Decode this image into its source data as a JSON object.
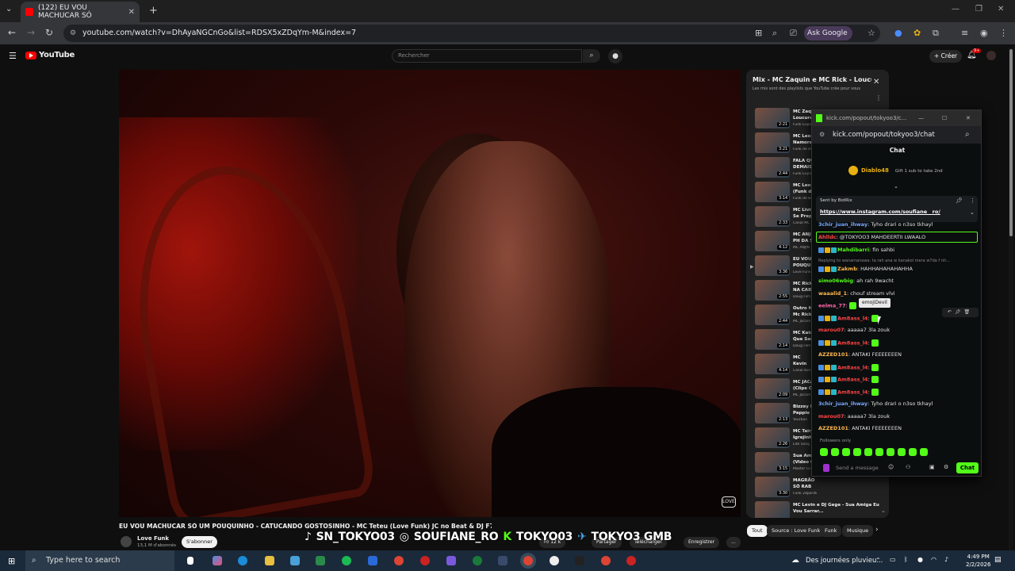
{
  "browser": {
    "tab_title": "(122) EU VOU MACHUCAR SÓ",
    "tab_close": "✕",
    "new_tab": "+",
    "url": "youtube.com/watch?v=DhAyaNGCnGo&list=RDSX5xZDqYm-M&index=7",
    "ask_google": "Ask Google"
  },
  "youtube": {
    "logo_text": "YouTube",
    "search_placeholder": "Rechercher",
    "create_label": "+ Créer",
    "notif_count": "9+"
  },
  "video": {
    "title": "EU VOU MACHUCAR SÓ UM POUQUINHO - CATUCANDO GOSTOSINHO - MC Teteu (Love Funk) JC no Beat & DJ F7",
    "channel_name": "Love Funk",
    "channel_subs": "13,1 M d'abonnés",
    "subscribe": "S'abonner",
    "like_count": "12 k",
    "share": "Partager",
    "download": "Télécharger",
    "save": "Enregistrer",
    "more": "..."
  },
  "overlay_socials": {
    "tiktok": "SN_TOKYO03",
    "instagram": "SOUFIANE_RO",
    "kick": "TOKYO03",
    "telegram": "TOKYO3 GMB"
  },
  "playlist": {
    "title": "Mix - MC Zaquin e MC Rick - Loucura",
    "subtitle": "Les mix sont des playlists que YouTube crée pour vous",
    "items": [
      {
        "name": "MC Zaq Loucura",
        "artist": "Funk Explo",
        "dur": "2:21"
      },
      {
        "name": "MC Leoz Namora",
        "artist": "Funk de Bl",
        "dur": "3:21"
      },
      {
        "name": "FALA QU DEMAIS",
        "artist": "Funk Explo",
        "dur": "2:44"
      },
      {
        "name": "MC Leoz (Funk de",
        "artist": "Funk de Bl",
        "dur": "3:14"
      },
      {
        "name": "MC Livin Se Prepa",
        "artist": "Canal MC",
        "dur": "2:33"
      },
      {
        "name": "MC ANJO PH DA S",
        "artist": "MC ANJIN",
        "dur": "4:12"
      },
      {
        "name": "EU VOU POUQUI",
        "artist": "Love Funk",
        "dur": "3:36"
      },
      {
        "name": "MC Rick NA CABE",
        "artist": "Doug Film",
        "dur": "2:55"
      },
      {
        "name": "Outro M Mc Rick",
        "artist": "MC Jacaré",
        "dur": "2:44"
      },
      {
        "name": "MC Kaio Que Sau",
        "artist": "Doug Film",
        "dur": "2:14"
      },
      {
        "name": "MC Kevin (KondZ",
        "artist": "Canal Kon",
        "dur": "4:14"
      },
      {
        "name": "MC JACA (Clipe O",
        "artist": "MC Jacaré",
        "dur": "2:09"
      },
      {
        "name": "Bizzey F Pappie -",
        "artist": "Yourban",
        "dur": "2:13"
      },
      {
        "name": "MC Tairi Igrejinha",
        "artist": "Lite Song",
        "dur": "2:26"
      },
      {
        "name": "Sua Ami (Video C",
        "artist": "Master Gro",
        "dur": "3:15"
      },
      {
        "name": "MAGRÃO SÓ RAB Oficial) DJ IDK",
        "artist": "Funk 24por48",
        "dur": "3:30"
      },
      {
        "name": "MC Levin e DJ Gege - Sua Amiga Eu Vou Sarrar...",
        "artist": "",
        "dur": ""
      }
    ]
  },
  "chips": [
    "Tout",
    "Source : Love Funk",
    "Funk",
    "Musique"
  ],
  "kick": {
    "window_title": "kick.com/popout/tokyoo3/c...",
    "url": "kick.com/popout/tokyoo3/chat",
    "chat_label": "Chat",
    "gift_user": "Diablo48",
    "gift_text": "Gift 1 sub to take 2nd",
    "pinned_by": "Sent by BotRix",
    "pinned_link": "https://www.instagram.com/soufiane__ro/",
    "messages": [
      {
        "user": "3chir_juan_ihway",
        "text": ": Tyho drari o n3so tkhayl",
        "color": "#7aa7ff"
      },
      {
        "user": "Ahlldc",
        "text": ": @TOKYOO3 MAHDEERTII LWAALO",
        "color": "#ff4444"
      },
      {
        "user": "Mahdibarri",
        "text": ": fin sahbi",
        "color": "#53fc18"
      },
      {
        "user": "",
        "text": "Replying to wanamanawa: ta rah ana w kanakol mera w7da f nh...",
        "color": "#888"
      },
      {
        "user": "Zakmb",
        "text": ": HAHHAHAHAHAHHA",
        "color": "#ffb84d"
      },
      {
        "user": "simo06wbig",
        "text": ": ah rah 9wacht",
        "color": "#53fc18"
      },
      {
        "user": "waaalid_1",
        "text": ": chouf stream vlvi",
        "color": "#ffb84d"
      },
      {
        "user": "eelma_77",
        "text": ":",
        "color": "#ff66aa"
      },
      {
        "user": "Am8ass_l4",
        "text": ":",
        "color": "#ff4444"
      },
      {
        "user": "marou07",
        "text": ": aaaaa7 3la zouk",
        "color": "#ff4444"
      },
      {
        "user": "Am8ass_l4",
        "text": ":",
        "color": "#ff4444"
      },
      {
        "user": "AZZED101",
        "text": ": ANTAKI FEEEEEEEN",
        "color": "#ffb84d"
      },
      {
        "user": "Am8ass_l4",
        "text": ":",
        "color": "#ff4444"
      },
      {
        "user": "Am8ass_l4",
        "text": ":",
        "color": "#ff4444"
      },
      {
        "user": "Am8ass_l4",
        "text": ":",
        "color": "#ff4444"
      },
      {
        "user": "3chir_juan_ihway",
        "text": ": Tyho drari o n3so tkhayl",
        "color": "#7aa7ff"
      },
      {
        "user": "marou07",
        "text": ": aaaaa7 3la zouk",
        "color": "#ff4444"
      },
      {
        "user": "AZZED101",
        "text": ": ANTAKI FEEEEEEEN",
        "color": "#ffb84d"
      }
    ],
    "tooltip": "emojiDevil",
    "followers_only": "Followers only",
    "send_placeholder": "Send a message",
    "chat_button": "Chat"
  },
  "taskbar": {
    "search_placeholder": "Type here to search",
    "news": "Des journées pluvieu...",
    "time": "4:49 PM",
    "date": "2/2/2026"
  },
  "colors": {
    "youtube_red": "#ff0000",
    "kick_green": "#53fc18",
    "bg_dark": "#0f0f0f",
    "panel": "#212121"
  }
}
